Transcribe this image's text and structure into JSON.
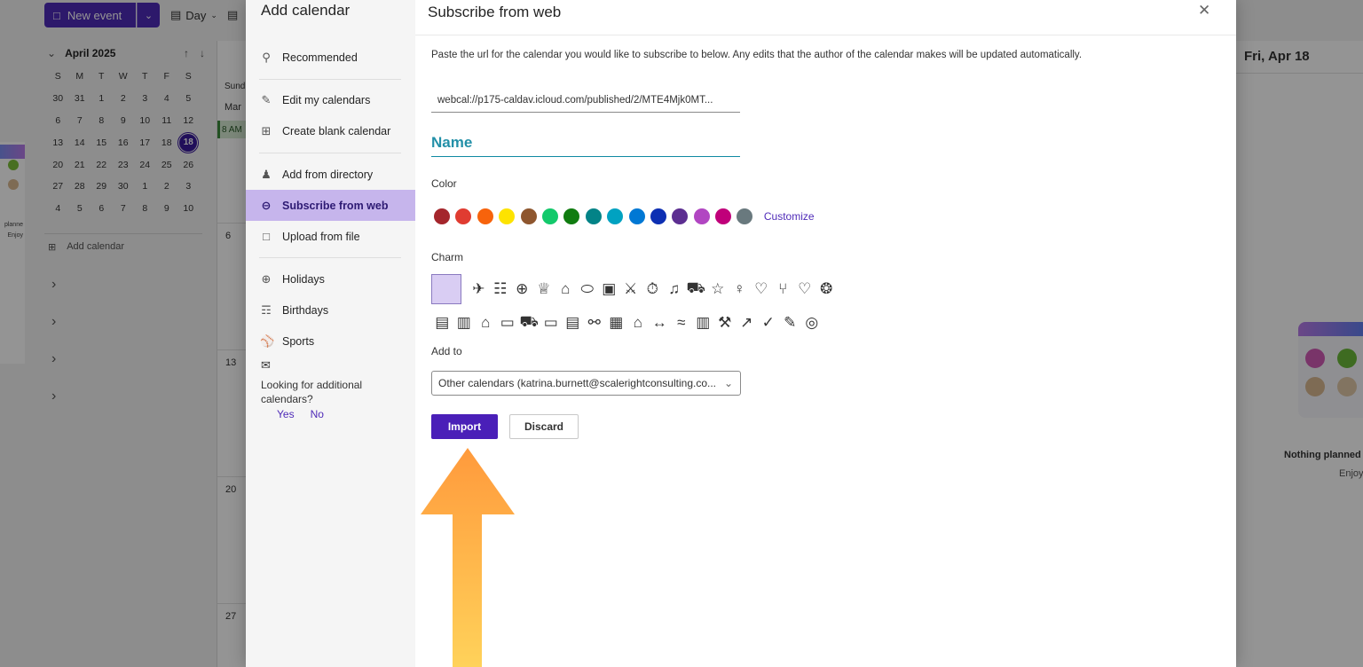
{
  "background": {
    "new_event_label": "New event",
    "view_label": "Day",
    "mini_calendar": {
      "month_label": "April 2025",
      "weekdays": [
        "S",
        "M",
        "T",
        "W",
        "T",
        "F",
        "S"
      ],
      "days": [
        "30",
        "31",
        "1",
        "2",
        "3",
        "4",
        "5",
        "6",
        "7",
        "8",
        "9",
        "10",
        "11",
        "12",
        "13",
        "14",
        "15",
        "16",
        "17",
        "18",
        "19",
        "20",
        "21",
        "22",
        "23",
        "24",
        "25",
        "26",
        "27",
        "28",
        "29",
        "30",
        "1",
        "2",
        "3",
        "4",
        "5",
        "6",
        "7",
        "8",
        "9",
        "10"
      ],
      "today": "18"
    },
    "add_calendar_label": "Add calendar",
    "week_labels": [
      "Sund",
      "Mar",
      "6",
      "13",
      "20",
      "27"
    ],
    "event_time": "8 AM",
    "left_card_text": [
      "planne",
      "Enjoy"
    ],
    "right_pane": {
      "date": "Fri, Apr 18",
      "nothing_planned": "Nothing planned",
      "enjoy": "Enjoy"
    }
  },
  "dialog": {
    "sidebar": {
      "title": "Add calendar",
      "items": [
        {
          "label": "Recommended",
          "icon": "lightbulb-icon"
        },
        {
          "label": "Edit my calendars",
          "icon": "edit-calendar-icon"
        },
        {
          "label": "Create blank calendar",
          "icon": "calendar-add-icon"
        },
        {
          "label": "Add from directory",
          "icon": "people-icon"
        },
        {
          "label": "Subscribe from web",
          "icon": "globe-icon"
        },
        {
          "label": "Upload from file",
          "icon": "document-icon"
        },
        {
          "label": "Holidays",
          "icon": "globe-icon"
        },
        {
          "label": "Birthdays",
          "icon": "cake-icon"
        },
        {
          "label": "Sports",
          "icon": "sports-ball-icon"
        }
      ],
      "looking_text": "Looking for additional calendars?",
      "yes_label": "Yes",
      "no_label": "No"
    },
    "content": {
      "title": "Subscribe from web",
      "description": "Paste the url for the calendar you would like to subscribe to below. Any edits that the author of the calendar makes will be updated automatically.",
      "url_value": "webcal://p175-caldav.icloud.com/published/2/MTE4Mjk0MT...",
      "name_placeholder": "Name",
      "color_label": "Color",
      "colors": [
        "#a4262c",
        "#e03c31",
        "#f7630c",
        "#fde300",
        "#8e562e",
        "#13c96b",
        "#107c10",
        "#038387",
        "#00a2c1",
        "#0078d4",
        "#0d2fb3",
        "#5c2e91",
        "#b146c2",
        "#c0007a",
        "#69797e"
      ],
      "customize_label": "Customize",
      "charm_label": "Charm",
      "charms_row1": [
        "calendar-blank-icon",
        "airplane-icon",
        "clipboard-icon",
        "first-aid-icon",
        "trophy-icon",
        "home-icon",
        "pill-icon",
        "briefcase-icon",
        "running-icon",
        "stopwatch-icon",
        "music-note-icon",
        "car-icon",
        "star-icon",
        "person-icon",
        "heart-broken-icon",
        "fork-knife-icon",
        "heart-icon",
        "soccer-ball-icon"
      ],
      "charms_row2": [
        "clapper-icon",
        "book-icon",
        "birthday-cake-icon",
        "monitor-icon",
        "truck-icon",
        "ticket-icon",
        "credit-card-icon",
        "bicycle-icon",
        "bus-icon",
        "graduation-cap-icon",
        "dumbbell-icon",
        "swimming-icon",
        "building-icon",
        "wrench-icon",
        "shoe-icon",
        "checkmark-icon",
        "note-edit-icon",
        "target-icon"
      ],
      "add_to_label": "Add to",
      "add_to_value": "Other calendars (katrina.burnett@scalerightconsulting.co...",
      "import_label": "Import",
      "discard_label": "Discard"
    }
  },
  "annotation": {
    "arrow_colors": [
      "#ff9a3c",
      "#ffd25a"
    ]
  }
}
